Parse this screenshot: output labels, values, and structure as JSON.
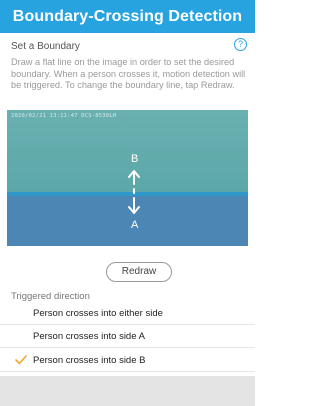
{
  "header": {
    "title": "Boundary-Crossing Detection"
  },
  "section": {
    "title": "Set a Boundary",
    "help_icon_glyph": "?",
    "instructions": "Draw a flat line on the image in order to set the desired boundary. When a person crosses it, motion detection will be triggered. To change the boundary line, tap Redraw."
  },
  "camera": {
    "timestamp": "2020/02/21 13:11:47 DCS-8530LH",
    "label_b": "B",
    "label_a": "A",
    "boundary_color": "#2f98c9"
  },
  "redraw": {
    "label": "Redraw"
  },
  "triggered": {
    "label": "Triggered direction",
    "options": [
      {
        "label": "Person crosses into either side",
        "selected": false
      },
      {
        "label": "Person crosses into side A",
        "selected": false
      },
      {
        "label": "Person crosses into side B",
        "selected": true
      }
    ]
  },
  "colors": {
    "accent": "#27a3e0",
    "check": "#f0a830"
  }
}
